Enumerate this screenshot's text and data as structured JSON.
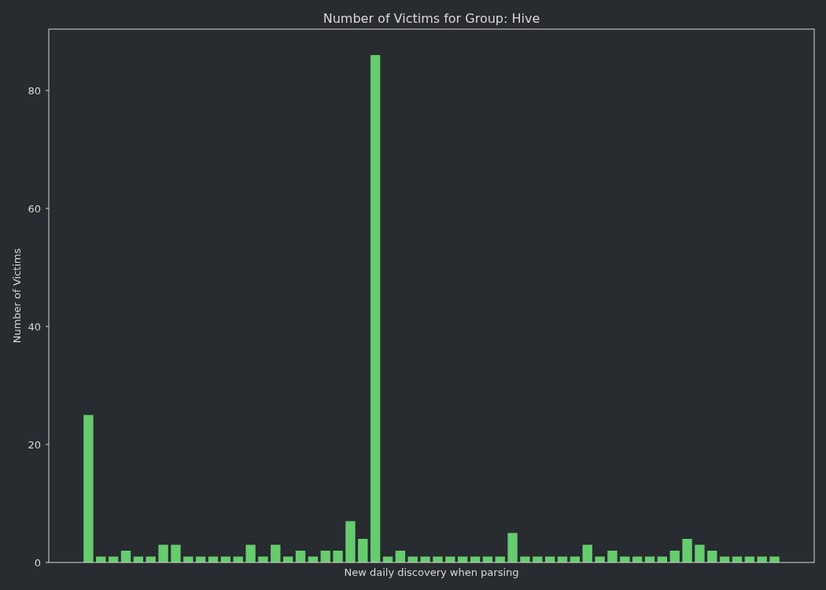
{
  "chart_data": {
    "type": "bar",
    "title": "Number of Victims for Group: Hive",
    "xlabel": "New daily discovery when parsing",
    "ylabel": "Number of Victims",
    "ylim": [
      0,
      90.4
    ],
    "yticks": [
      0,
      20,
      40,
      60,
      80
    ],
    "series": [
      {
        "color": "#66cc6e",
        "values": [
          25,
          1,
          1,
          2,
          1,
          1,
          3,
          3,
          1,
          1,
          1,
          1,
          1,
          3,
          1,
          3,
          1,
          2,
          1,
          2,
          2,
          7,
          4,
          86,
          1,
          2,
          1,
          1,
          1,
          1,
          1,
          1,
          1,
          1,
          5,
          1,
          1,
          1,
          1,
          1,
          3,
          1,
          2,
          1,
          1,
          1,
          1,
          2,
          4,
          3,
          2,
          1,
          1,
          1,
          1,
          1
        ]
      }
    ]
  }
}
